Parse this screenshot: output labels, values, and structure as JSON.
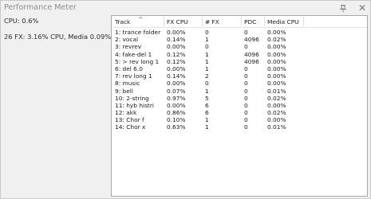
{
  "window": {
    "title": "Performance Meter",
    "pin_icon": "pin-icon",
    "close_glyph": "✕"
  },
  "summary": {
    "cpu": "CPU: 0.6%",
    "fx": "26 FX: 3.16% CPU, Media 0.09%"
  },
  "table": {
    "columns": [
      "Track",
      "FX CPU",
      "# FX",
      "PDC",
      "Media CPU"
    ],
    "sorted_column": "Track",
    "rows": [
      {
        "track": "1: trance folder",
        "fx_cpu": "0.00%",
        "num_fx": "0",
        "pdc": "0",
        "media_cpu": "0.00%"
      },
      {
        "track": "2: vocal",
        "fx_cpu": "0.14%",
        "num_fx": "1",
        "pdc": "4096",
        "media_cpu": "0.02%"
      },
      {
        "track": "3: revrev",
        "fx_cpu": "0.00%",
        "num_fx": "0",
        "pdc": "0",
        "media_cpu": "0.00%"
      },
      {
        "track": "4: fake-del 1",
        "fx_cpu": "0.12%",
        "num_fx": "1",
        "pdc": "4096",
        "media_cpu": "0.00%"
      },
      {
        "track": "5: > rev long 1",
        "fx_cpu": "0.12%",
        "num_fx": "1",
        "pdc": "4096",
        "media_cpu": "0.00%"
      },
      {
        "track": "6: del 6.0",
        "fx_cpu": "0.00%",
        "num_fx": "1",
        "pdc": "0",
        "media_cpu": "0.00%"
      },
      {
        "track": "7: rev long 1",
        "fx_cpu": "0.14%",
        "num_fx": "2",
        "pdc": "0",
        "media_cpu": "0.00%"
      },
      {
        "track": "8: music",
        "fx_cpu": "0.00%",
        "num_fx": "0",
        "pdc": "0",
        "media_cpu": "0.00%"
      },
      {
        "track": "9: bell",
        "fx_cpu": "0.07%",
        "num_fx": "1",
        "pdc": "0",
        "media_cpu": "0.01%"
      },
      {
        "track": "10: 2-string",
        "fx_cpu": "0.97%",
        "num_fx": "5",
        "pdc": "0",
        "media_cpu": "0.02%"
      },
      {
        "track": "11: hyb histri",
        "fx_cpu": "0.00%",
        "num_fx": "6",
        "pdc": "0",
        "media_cpu": "0.00%"
      },
      {
        "track": "12: akk",
        "fx_cpu": "0.86%",
        "num_fx": "6",
        "pdc": "0",
        "media_cpu": "0.02%"
      },
      {
        "track": "13: Chor f",
        "fx_cpu": "0.10%",
        "num_fx": "1",
        "pdc": "0",
        "media_cpu": "0.00%"
      },
      {
        "track": "14: Chor x",
        "fx_cpu": "0.63%",
        "num_fx": "1",
        "pdc": "0",
        "media_cpu": "0.01%"
      }
    ]
  }
}
